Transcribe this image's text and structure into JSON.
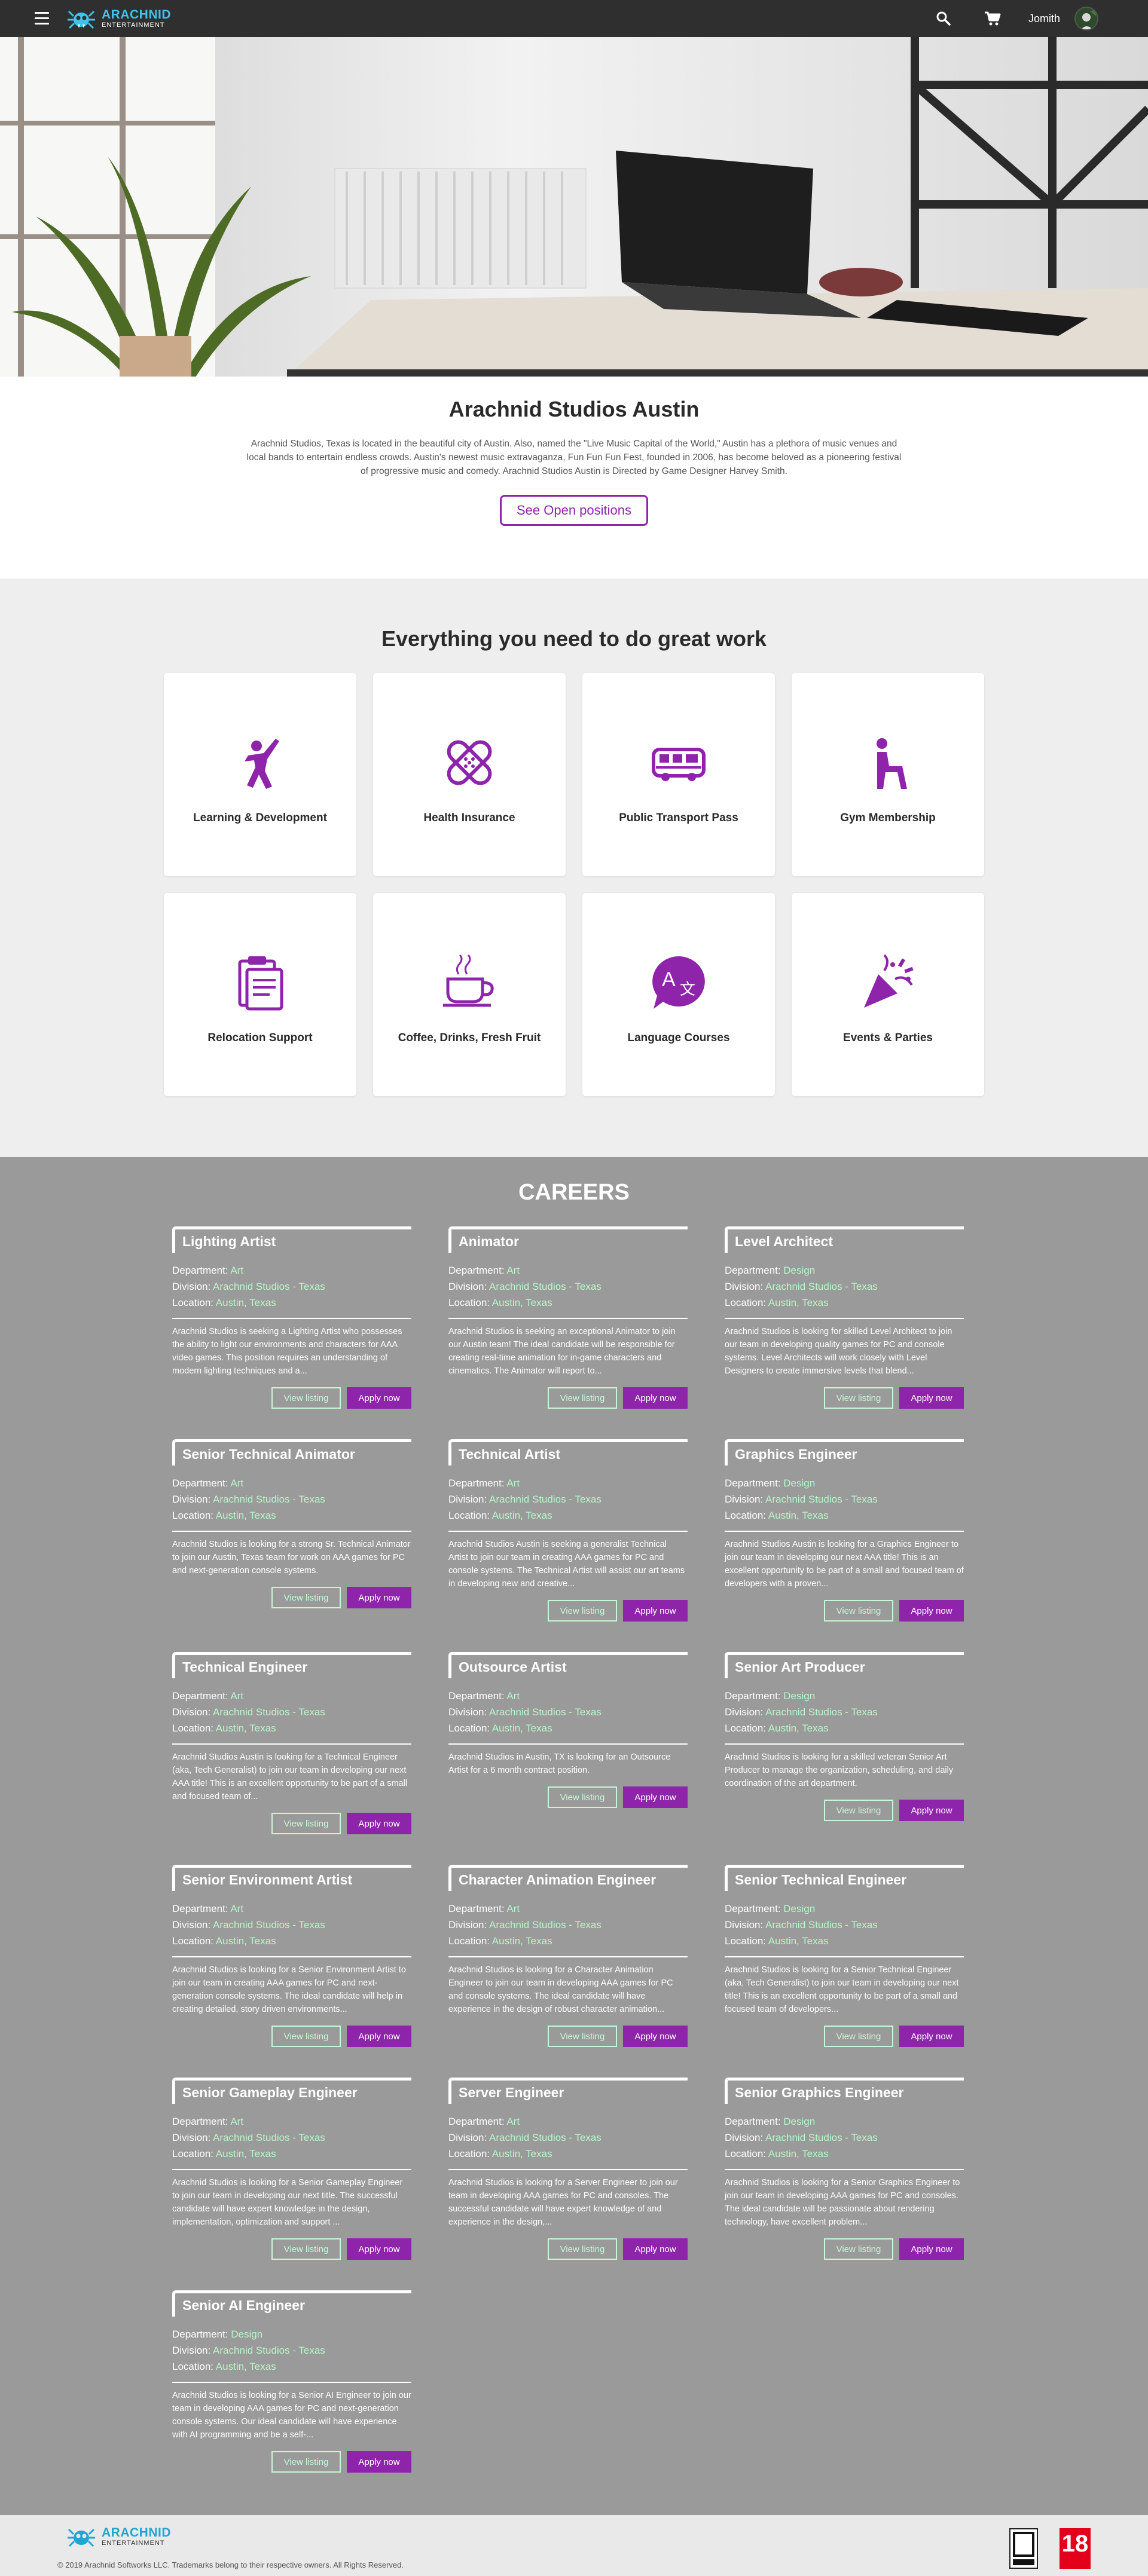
{
  "nav": {
    "logo_main": "ARACHNID",
    "logo_sub": "ENTERTAINMENT",
    "username": "Jomith"
  },
  "intro": {
    "title": "Arachnid Studios Austin",
    "text": "Arachnid Studios, Texas is located in the beautiful city of Austin. Also, named the \"Live Music Capital of the World,\" Austin has a plethora of music venues and local bands to entertain endless crowds. Austin's newest music extravaganza, Fun Fun Fun Fest, founded in 2006, has become beloved as a pioneering festival of progressive music and comedy. Arachnid Studios Austin is Directed by Game Designer Harvey Smith.",
    "button": "See Open positions"
  },
  "perks": {
    "title": "Everything you need to do great work",
    "items": [
      {
        "label": "Learning & Development",
        "icon": "learning-icon"
      },
      {
        "label": "Health Insurance",
        "icon": "bandage-icon"
      },
      {
        "label": "Public Transport Pass",
        "icon": "bus-icon"
      },
      {
        "label": "Gym Membership",
        "icon": "gym-icon"
      },
      {
        "label": "Relocation Support",
        "icon": "clipboard-icon"
      },
      {
        "label": "Coffee, Drinks, Fresh Fruit",
        "icon": "coffee-icon"
      },
      {
        "label": "Language Courses",
        "icon": "translate-icon"
      },
      {
        "label": "Events & Parties",
        "icon": "party-icon"
      }
    ]
  },
  "careers": {
    "title": "CAREERS",
    "labels": {
      "department": "Department:",
      "division": "Division:",
      "location": "Location:",
      "view": "View listing",
      "apply": "Apply now"
    },
    "jobs": [
      {
        "title": "Lighting Artist",
        "department": "Art",
        "division": "Arachnid Studios - Texas",
        "location": "Austin, Texas",
        "desc": "Arachnid Studios is seeking a Lighting Artist who possesses the ability to light our environments and characters for AAA video games. This position requires an understanding of modern lighting techniques and a..."
      },
      {
        "title": "Animator",
        "department": "Art",
        "division": "Arachnid Studios - Texas",
        "location": "Austin, Texas",
        "desc": "Arachnid Studios is seeking an exceptional Animator to join our Austin team! The ideal candidate will be responsible for creating real-time animation for in-game characters and cinematics. The Animator will report to..."
      },
      {
        "title": "Level Architect",
        "department": "Design",
        "division": "Arachnid Studios - Texas",
        "location": "Austin, Texas",
        "desc": "Arachnid Studios is looking for skilled Level Architect to join our team in developing quality games for PC and console systems. Level Architects will work closely with Level Designers to create immersive levels that blend..."
      },
      {
        "title": "Senior Technical Animator",
        "department": "Art",
        "division": "Arachnid Studios - Texas",
        "location": "Austin, Texas",
        "desc": "Arachnid Studios is looking for a strong Sr. Technical Animator to join our Austin, Texas team for work on AAA games for PC and next-generation console systems."
      },
      {
        "title": "Technical Artist",
        "department": "Art",
        "division": "Arachnid Studios - Texas",
        "location": "Austin, Texas",
        "desc": "Arachnid Studios Austin is seeking a generalist Technical Artist to join our team in creating AAA games for PC and console systems. The Technical Artist will assist our art teams in developing new and creative..."
      },
      {
        "title": "Graphics Engineer",
        "department": "Design",
        "division": "Arachnid Studios - Texas",
        "location": "Austin, Texas",
        "desc": "Arachnid Studios Austin is looking for a Graphics Engineer to join our team in developing our next AAA title! This is an excellent opportunity to be part of a small and focused team of developers with a proven..."
      },
      {
        "title": "Technical Engineer",
        "department": "Art",
        "division": "Arachnid Studios - Texas",
        "location": "Austin, Texas",
        "desc": "Arachnid Studios Austin is looking for a Technical Engineer (aka, Tech Generalist) to join our team in developing our next AAA title! This is an excellent opportunity to be part of a small and focused team of..."
      },
      {
        "title": "Outsource Artist",
        "department": "Art",
        "division": "Arachnid Studios - Texas",
        "location": "Austin, Texas",
        "desc": "Arachnid Studios in Austin, TX is looking for an Outsource Artist for a 6 month contract position."
      },
      {
        "title": "Senior Art Producer",
        "department": "Design",
        "division": "Arachnid Studios - Texas",
        "location": "Austin, Texas",
        "desc": "Arachnid Studios is looking for a skilled veteran Senior Art Producer to manage the organization, scheduling, and daily coordination of the art department."
      },
      {
        "title": "Senior Environment Artist",
        "department": "Art",
        "division": "Arachnid Studios - Texas",
        "location": "Austin, Texas",
        "desc": "Arachnid Studios is looking for a Senior Environment Artist to join our team in creating AAA games for PC and next-generation console systems. The ideal candidate will help in creating detailed, story driven environments..."
      },
      {
        "title": "Character Animation Engineer",
        "department": "Art",
        "division": "Arachnid Studios - Texas",
        "location": "Austin, Texas",
        "desc": "Arachnid Studios is looking for a Character Animation Engineer to join our team in developing AAA games for PC and console systems. The ideal candidate will have experience in the design of robust character animation..."
      },
      {
        "title": "Senior Technical Engineer",
        "department": "Design",
        "division": "Arachnid Studios - Texas",
        "location": "Austin, Texas",
        "desc": "Arachnid Studios is looking for a Senior Technical Engineer (aka, Tech Generalist) to join our team in developing our next title! This is an excellent opportunity to be part of a small and focused team of developers..."
      },
      {
        "title": "Senior Gameplay Engineer",
        "department": "Art",
        "division": "Arachnid Studios - Texas",
        "location": "Austin, Texas",
        "desc": "Arachnid Studios is looking for a Senior Gameplay Engineer to join our team in developing our next title. The successful candidate will have expert knowledge in the design, implementation, optimization and support ..."
      },
      {
        "title": "Server Engineer",
        "department": "Art",
        "division": "Arachnid Studios - Texas",
        "location": "Austin, Texas",
        "desc": "Arachnid Studios is looking for a Server Engineer to join our team in developing AAA games for PC and consoles. The successful candidate will have expert knowledge of and experience in the design,..."
      },
      {
        "title": "Senior Graphics Engineer",
        "department": "Design",
        "division": "Arachnid Studios - Texas",
        "location": "Austin, Texas",
        "desc": "Arachnid Studios is looking for a Senior Graphics Engineer to join our team in developing AAA games for PC and consoles. The ideal candidate will be passionate about rendering technology, have excellent problem..."
      },
      {
        "title": "Senior AI Engineer",
        "department": "Design",
        "division": "Arachnid Studios - Texas",
        "location": "Austin, Texas",
        "desc": "Arachnid Studios is looking for a Senior AI Engineer to join our team in developing AAA games for PC and next-generation console systems. Our ideal candidate will have experience with AI programming and be a self-..."
      }
    ]
  },
  "footer": {
    "logo_main": "ARACHNID",
    "logo_sub": "ENTERTAINMENT",
    "copyright": "© 2019 Arachnid Softworks LLC. Trademarks belong to their respective owners. All Rights Reserved.",
    "pegi": "18"
  },
  "colors": {
    "accent": "#8e24aa",
    "link_green": "#b9f6ca",
    "nav_bg": "#2f2f2f",
    "careers_bg": "#9a9a9a"
  }
}
